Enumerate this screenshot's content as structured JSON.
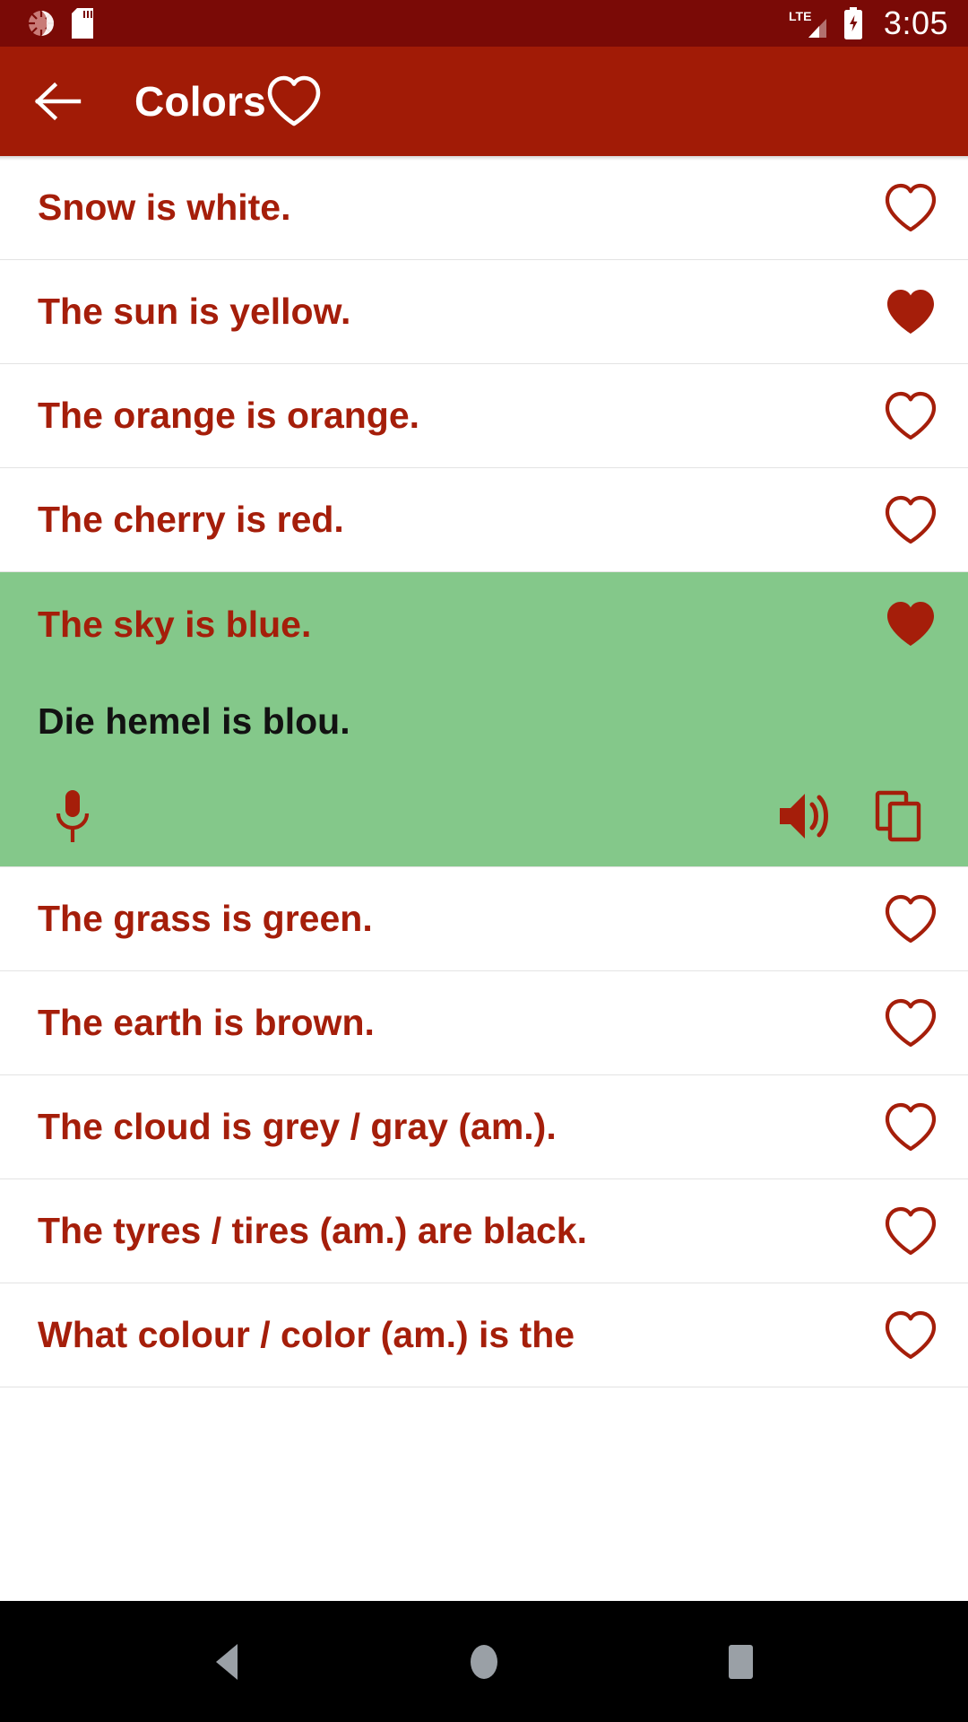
{
  "status_bar": {
    "icons_left": [
      "screen-record-icon",
      "sd-card-icon"
    ],
    "network_label": "LTE",
    "icons_right": [
      "lte-signal-icon",
      "battery-charging-icon"
    ],
    "time": "3:05",
    "background_color": "#7A0A06"
  },
  "app_bar": {
    "back_label": "back-arrow-icon",
    "title": "Colors",
    "favorite_icon": "heart-outline-icon",
    "background_color": "#A11B06"
  },
  "theme": {
    "accent_red": "#A51E0A",
    "app_bar_red": "#A11B06",
    "status_red": "#7A0A06",
    "selected_green": "#84C88A",
    "divider": "#e3e3e3"
  },
  "list": {
    "rows": [
      {
        "text": "Snow is white.",
        "favorite": false
      },
      {
        "text": "The sun is yellow.",
        "favorite": true
      },
      {
        "text": "The orange is orange.",
        "favorite": false
      },
      {
        "text": "The cherry is red.",
        "favorite": false
      }
    ],
    "expanded_row": {
      "source_text": "The sky is blue.",
      "target_text": "Die hemel is blou.",
      "favorite": true,
      "actions": {
        "mic": "microphone-icon",
        "speaker": "speaker-volume-icon",
        "copy": "copy-icon"
      }
    },
    "rows_after": [
      {
        "text": "The grass is green.",
        "favorite": false
      },
      {
        "text": "The earth is brown.",
        "favorite": false
      },
      {
        "text": "The cloud is grey / gray (am.).",
        "favorite": false
      },
      {
        "text": "The tyres / tires (am.) are black.",
        "favorite": false
      }
    ],
    "partial_row": {
      "text": "What colour / color (am.) is the",
      "favorite": false
    }
  },
  "nav_bar": {
    "back": "nav-back-icon",
    "home": "nav-home-icon",
    "recents": "nav-recents-icon"
  }
}
